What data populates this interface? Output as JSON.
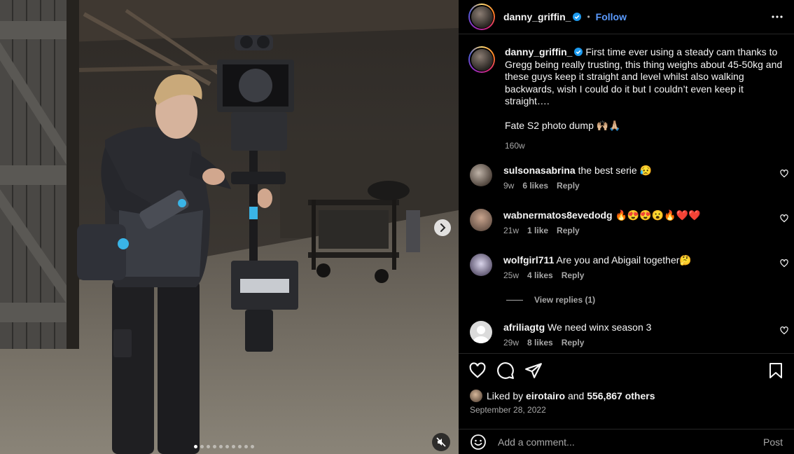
{
  "post": {
    "author": "danny_griffin_",
    "follow_label": "Follow",
    "separator": "•",
    "caption_line1": "First time ever using a steady cam thanks to Gregg being really trusting, this thing weighs about 45-50kg and these guys keep it straight and level whilst also walking backwards, wish I could do it but I couldn’t even keep it straight….",
    "caption_line2": "Fate S2 photo dump 🙌🏼🙏🏼",
    "caption_age": "160w"
  },
  "comments": [
    {
      "user": "sulsonasabrina",
      "text": "the best serie 😥",
      "age": "9w",
      "likes": "6 likes",
      "reply": "Reply"
    },
    {
      "user": "wabnermatos8evedodg",
      "text": "🔥😍😍😮🔥❤️❤️",
      "age": "21w",
      "likes": "1 like",
      "reply": "Reply"
    },
    {
      "user": "wolfgirl711",
      "text": "Are you and Abigail together🤔",
      "age": "25w",
      "likes": "4 likes",
      "reply": "Reply",
      "view_replies": "View replies (1)"
    },
    {
      "user": "afriliagtg",
      "text": "We need winx season 3",
      "age": "29w",
      "likes": "8 likes",
      "reply": "Reply"
    }
  ],
  "likes": {
    "prefix": "Liked by",
    "first_user": "eirotairo",
    "conjunction": "and",
    "others": "556,867 others"
  },
  "date": "September 28, 2022",
  "add_comment": {
    "placeholder": "Add a comment...",
    "post_label": "Post"
  },
  "carousel": {
    "total": 10,
    "current": 1
  },
  "colors": {
    "accent": "#0095f6",
    "verified": "#1d9bf0",
    "background": "#000000"
  }
}
